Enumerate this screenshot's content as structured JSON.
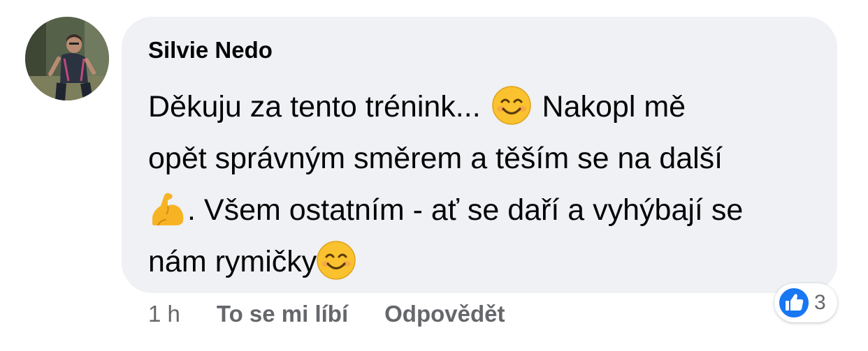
{
  "comment": {
    "author": "Silvie Nedo",
    "text_lines": [
      [
        "Děkuju za tento trénink... ",
        " Nakopl mě"
      ],
      [
        "opět správným směrem a těším se na další"
      ],
      [
        ". Všem ostatním - ať se daří a vyhýbají se"
      ],
      [
        "nám rymičky"
      ]
    ],
    "emojis": [
      "smiling-face-emoji",
      "flexed-biceps-emoji",
      "smiling-face-emoji"
    ]
  },
  "meta": {
    "time": "1 h",
    "like_label": "To se mi líbí",
    "reply_label": "Odpovědět"
  },
  "reactions": {
    "icon": "like-icon",
    "count": "3",
    "color": "#1877f2"
  }
}
